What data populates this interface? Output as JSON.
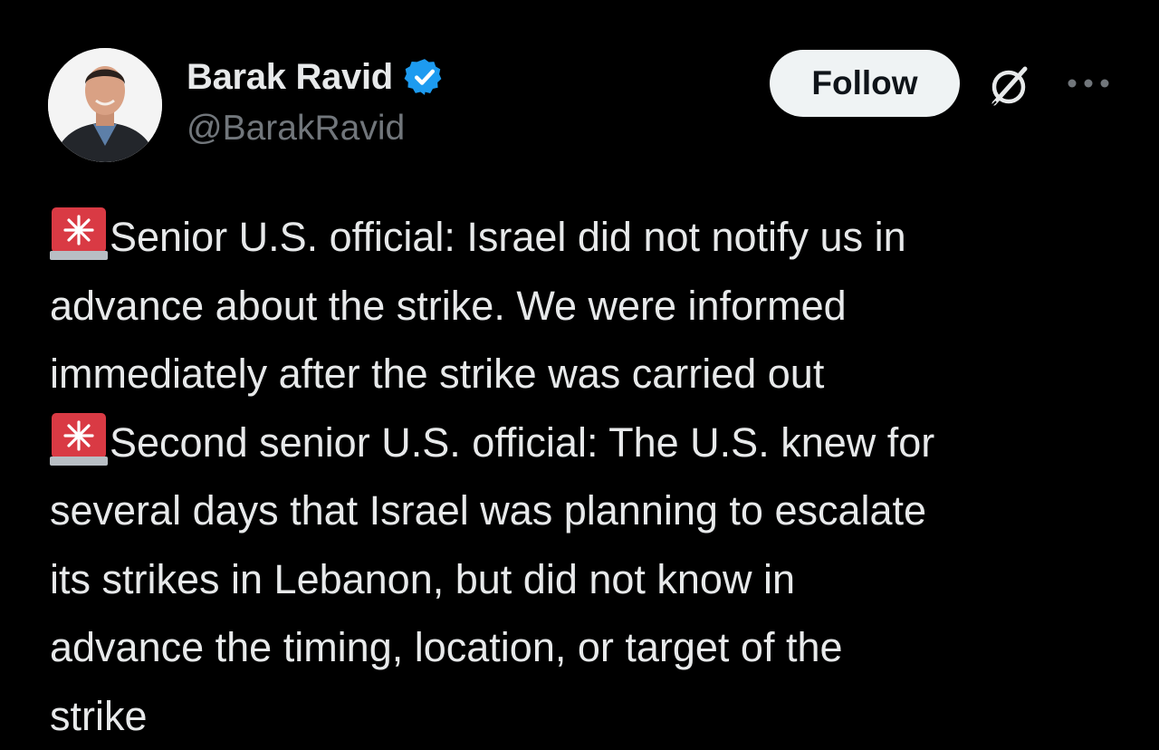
{
  "author": {
    "display_name": "Barak Ravid",
    "handle": "@BarakRavid",
    "verified": true,
    "verified_color": "#1d9bf0"
  },
  "actions": {
    "follow_label": "Follow",
    "grok_icon": "grok-icon",
    "more_icon": "more-options-icon"
  },
  "tweet": {
    "emoji": "siren-icon",
    "lines": [
      "Senior U.S. official: Israel did not notify us in",
      "advance about the strike. We were informed",
      "immediately after the strike was carried out",
      "Second senior U.S. official: The U.S. knew for",
      "several days that Israel was planning to escalate",
      "its strikes in Lebanon, but did not know in",
      "advance the timing, location, or target of the",
      "strike"
    ]
  },
  "theme": {
    "background": "#000000",
    "text": "#e7e9ea",
    "secondary_text": "#71767b",
    "button_bg": "#eff3f4"
  }
}
